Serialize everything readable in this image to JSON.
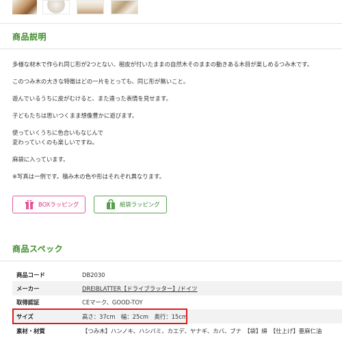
{
  "thumbnails": [
    "product-photo-1",
    "product-photo-2",
    "product-photo-3",
    "product-photo-4"
  ],
  "description": {
    "title": "商品説明",
    "paragraphs": [
      "多様な材木で作られ同じ形が2つとない、樹皮が付いたままの自然木そのままの動きある木目が楽しめるつみ木です。",
      "このつみ木の大きな特徴はどの一片をとっても、同じ形が無いこと。",
      "遊んでいるうちに皮がむけると、また違った表情を見せます。",
      "子どもたちは思いつくまま想像豊かに遊びます。",
      "使っていくうちに色合いもなじんで",
      "変わっていくのも楽しいですね。",
      "麻袋に入っています。",
      "※写真は一例です。積み木の色や形はそれぞれ異なります。"
    ]
  },
  "wrapping": {
    "box_label": "BOXラッピング",
    "bag_label": "紙袋ラッピング",
    "box_color": "#e3569a",
    "bag_color": "#55a04a"
  },
  "spec": {
    "title": "商品スペック",
    "rows": [
      {
        "key": "商品コード",
        "value": "DB2030"
      },
      {
        "key": "メーカー",
        "value": "DREIBLATTER【ドライブラッター】/ドイツ"
      },
      {
        "key": "取得認証",
        "value": "CEマーク、GOOD-TOY"
      },
      {
        "key": "サイズ",
        "value": "高さ：37cm　幅：25cm　奥行：15cm"
      },
      {
        "key": "素材・材質",
        "value": "【つみ木】ハンノキ、ハシバミ、カエデ、ヤナギ、カバ、ブナ　【袋】綿　【仕上げ】亜麻仁油"
      }
    ]
  },
  "colors": {
    "accent_green": "#3c8d26",
    "highlight_red": "#e01818"
  }
}
